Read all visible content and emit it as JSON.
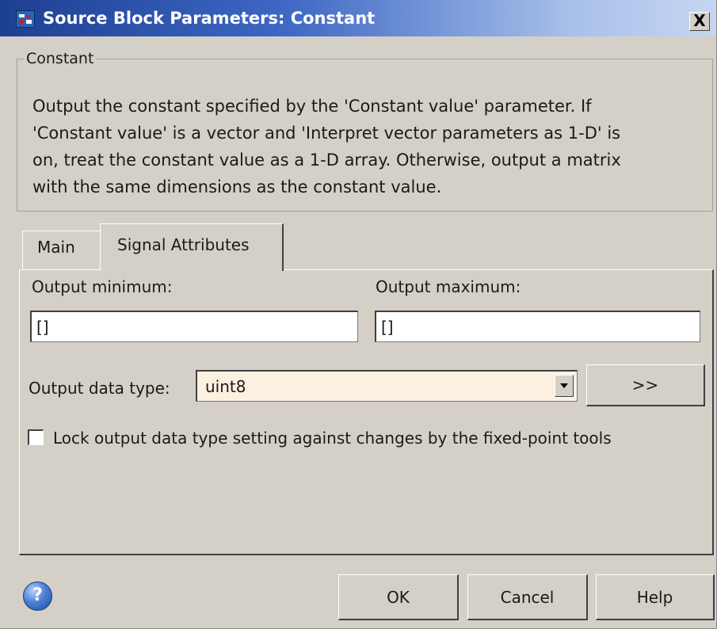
{
  "window": {
    "title": "Source Block Parameters: Constant",
    "close_symbol": "X"
  },
  "group": {
    "legend": "Constant",
    "description": "Output the constant specified by the 'Constant value' parameter. If\n'Constant value' is a vector and 'Interpret vector parameters as 1-D' is\non, treat the constant value as a 1-D array. Otherwise, output a matrix\nwith the same dimensions as the constant value."
  },
  "tabs": [
    {
      "label": "Main",
      "active": false
    },
    {
      "label": "Signal Attributes",
      "active": true
    }
  ],
  "signal_attributes": {
    "output_min_label": "Output minimum:",
    "output_min_value": "[]",
    "output_max_label": "Output maximum:",
    "output_max_value": "[]",
    "data_type_label": "Output data type:",
    "data_type_value": "uint8",
    "assistant_button": ">>",
    "lock_label": "Lock output data type setting against changes by the fixed-point tools",
    "lock_checked": false
  },
  "buttons": {
    "help_icon_glyph": "?",
    "ok": "OK",
    "cancel": "Cancel",
    "help": "Help"
  },
  "colors": {
    "titlebar_start": "#1d3f93",
    "dialog_bg": "#d4d0c8",
    "select_bg": "#fcf1e1"
  },
  "icons": [
    "simulink-block-icon",
    "close-icon",
    "dropdown-arrow-icon",
    "help-circle-icon"
  ]
}
